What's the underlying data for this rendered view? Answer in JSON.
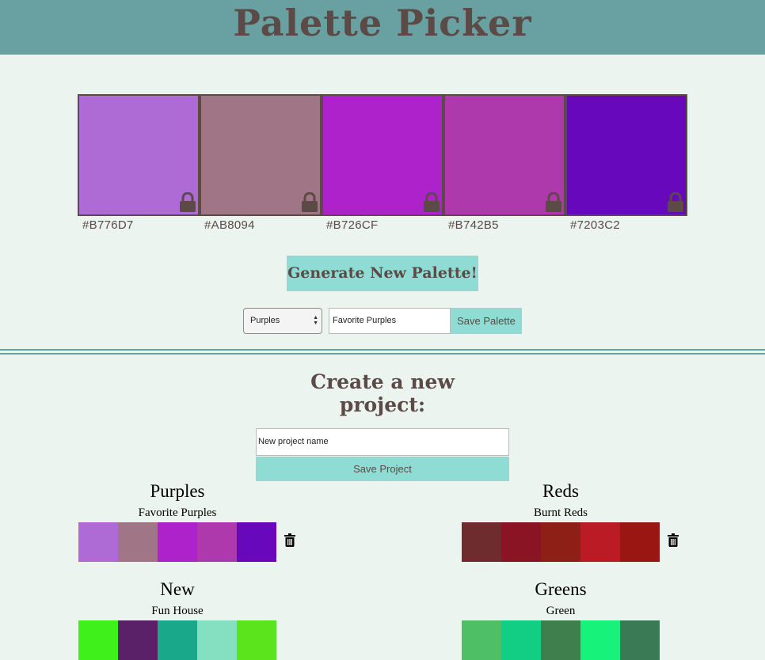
{
  "app": {
    "title": "Palette Picker"
  },
  "current_palette": [
    {
      "hex": "#B776D7",
      "color": "#AE6BD6",
      "lock_icon": "lock-icon"
    },
    {
      "hex": "#AB8094",
      "color": "#A07585",
      "lock_icon": "lock-icon"
    },
    {
      "hex": "#B726CF",
      "color": "#AE22CC",
      "lock_icon": "lock-icon"
    },
    {
      "hex": "#B742B5",
      "color": "#AD39AD",
      "lock_icon": "lock-icon"
    },
    {
      "hex": "#7203C2",
      "color": "#6808BC",
      "lock_icon": "lock-icon"
    }
  ],
  "controls": {
    "generate_label": "Generate New Palette!",
    "project_select_value": "Purples",
    "palette_name_value": "Favorite Purples",
    "save_palette_label": "Save Palette"
  },
  "new_project": {
    "heading": "Create a new project:",
    "input_placeholder": "New project name",
    "save_label": "Save Project"
  },
  "projects": [
    {
      "name": "Purples",
      "palette_name": "Favorite Purples",
      "colors": [
        "#AE6BD6",
        "#A07585",
        "#AE22CC",
        "#AD39AD",
        "#6808BC"
      ]
    },
    {
      "name": "Reds",
      "palette_name": "Burnt Reds",
      "colors": [
        "#6E2C2E",
        "#8A1424",
        "#8E1F17",
        "#BA1B24",
        "#9A1612"
      ]
    },
    {
      "name": "New",
      "palette_name": "Fun House",
      "colors": [
        "#3FF01A",
        "#5B2168",
        "#19A98A",
        "#84E0C1",
        "#5BE31B"
      ]
    },
    {
      "name": "Greens",
      "palette_name": "Green",
      "colors": [
        "#4FBF66",
        "#12CE85",
        "#3F7F4E",
        "#16F27A",
        "#3A7A54"
      ]
    }
  ],
  "colors": {
    "header_bg": "#69A1A3",
    "page_bg": "#EBF4EF",
    "button_bg": "#8FDCD4",
    "text": "#5B4A45"
  }
}
